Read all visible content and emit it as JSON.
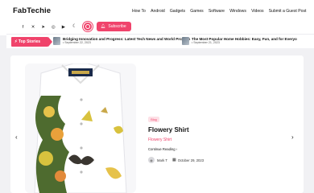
{
  "brand": "FabTechie",
  "nav": [
    "How To",
    "Android",
    "Gadgets",
    "Games",
    "Software",
    "Windows",
    "Videos",
    "Submit a Guest Post"
  ],
  "social_icons": [
    "facebook-icon",
    "x-icon",
    "telegram-icon",
    "instagram-icon",
    "youtube-icon"
  ],
  "subscribe_label": "Subscribe",
  "top_stories_label": "Top Stories",
  "stories": [
    {
      "title": "...",
      "date": ""
    },
    {
      "title": "Bridging Innovation and Progress: Latest Tech News and World Projects",
      "date": "September 22, 2023"
    },
    {
      "title": "The Most Popular Home Hobbies: Easy, Fun, and for Everyo",
      "date": "September 21, 2023"
    }
  ],
  "post": {
    "category": "Blog",
    "title": "Flowery Shirt",
    "excerpt": "Flowery Shirt",
    "continue_label": "Continue Reading",
    "author": "Mark T",
    "date": "October 29, 2023"
  },
  "colors": {
    "accent": "#f0436b"
  }
}
